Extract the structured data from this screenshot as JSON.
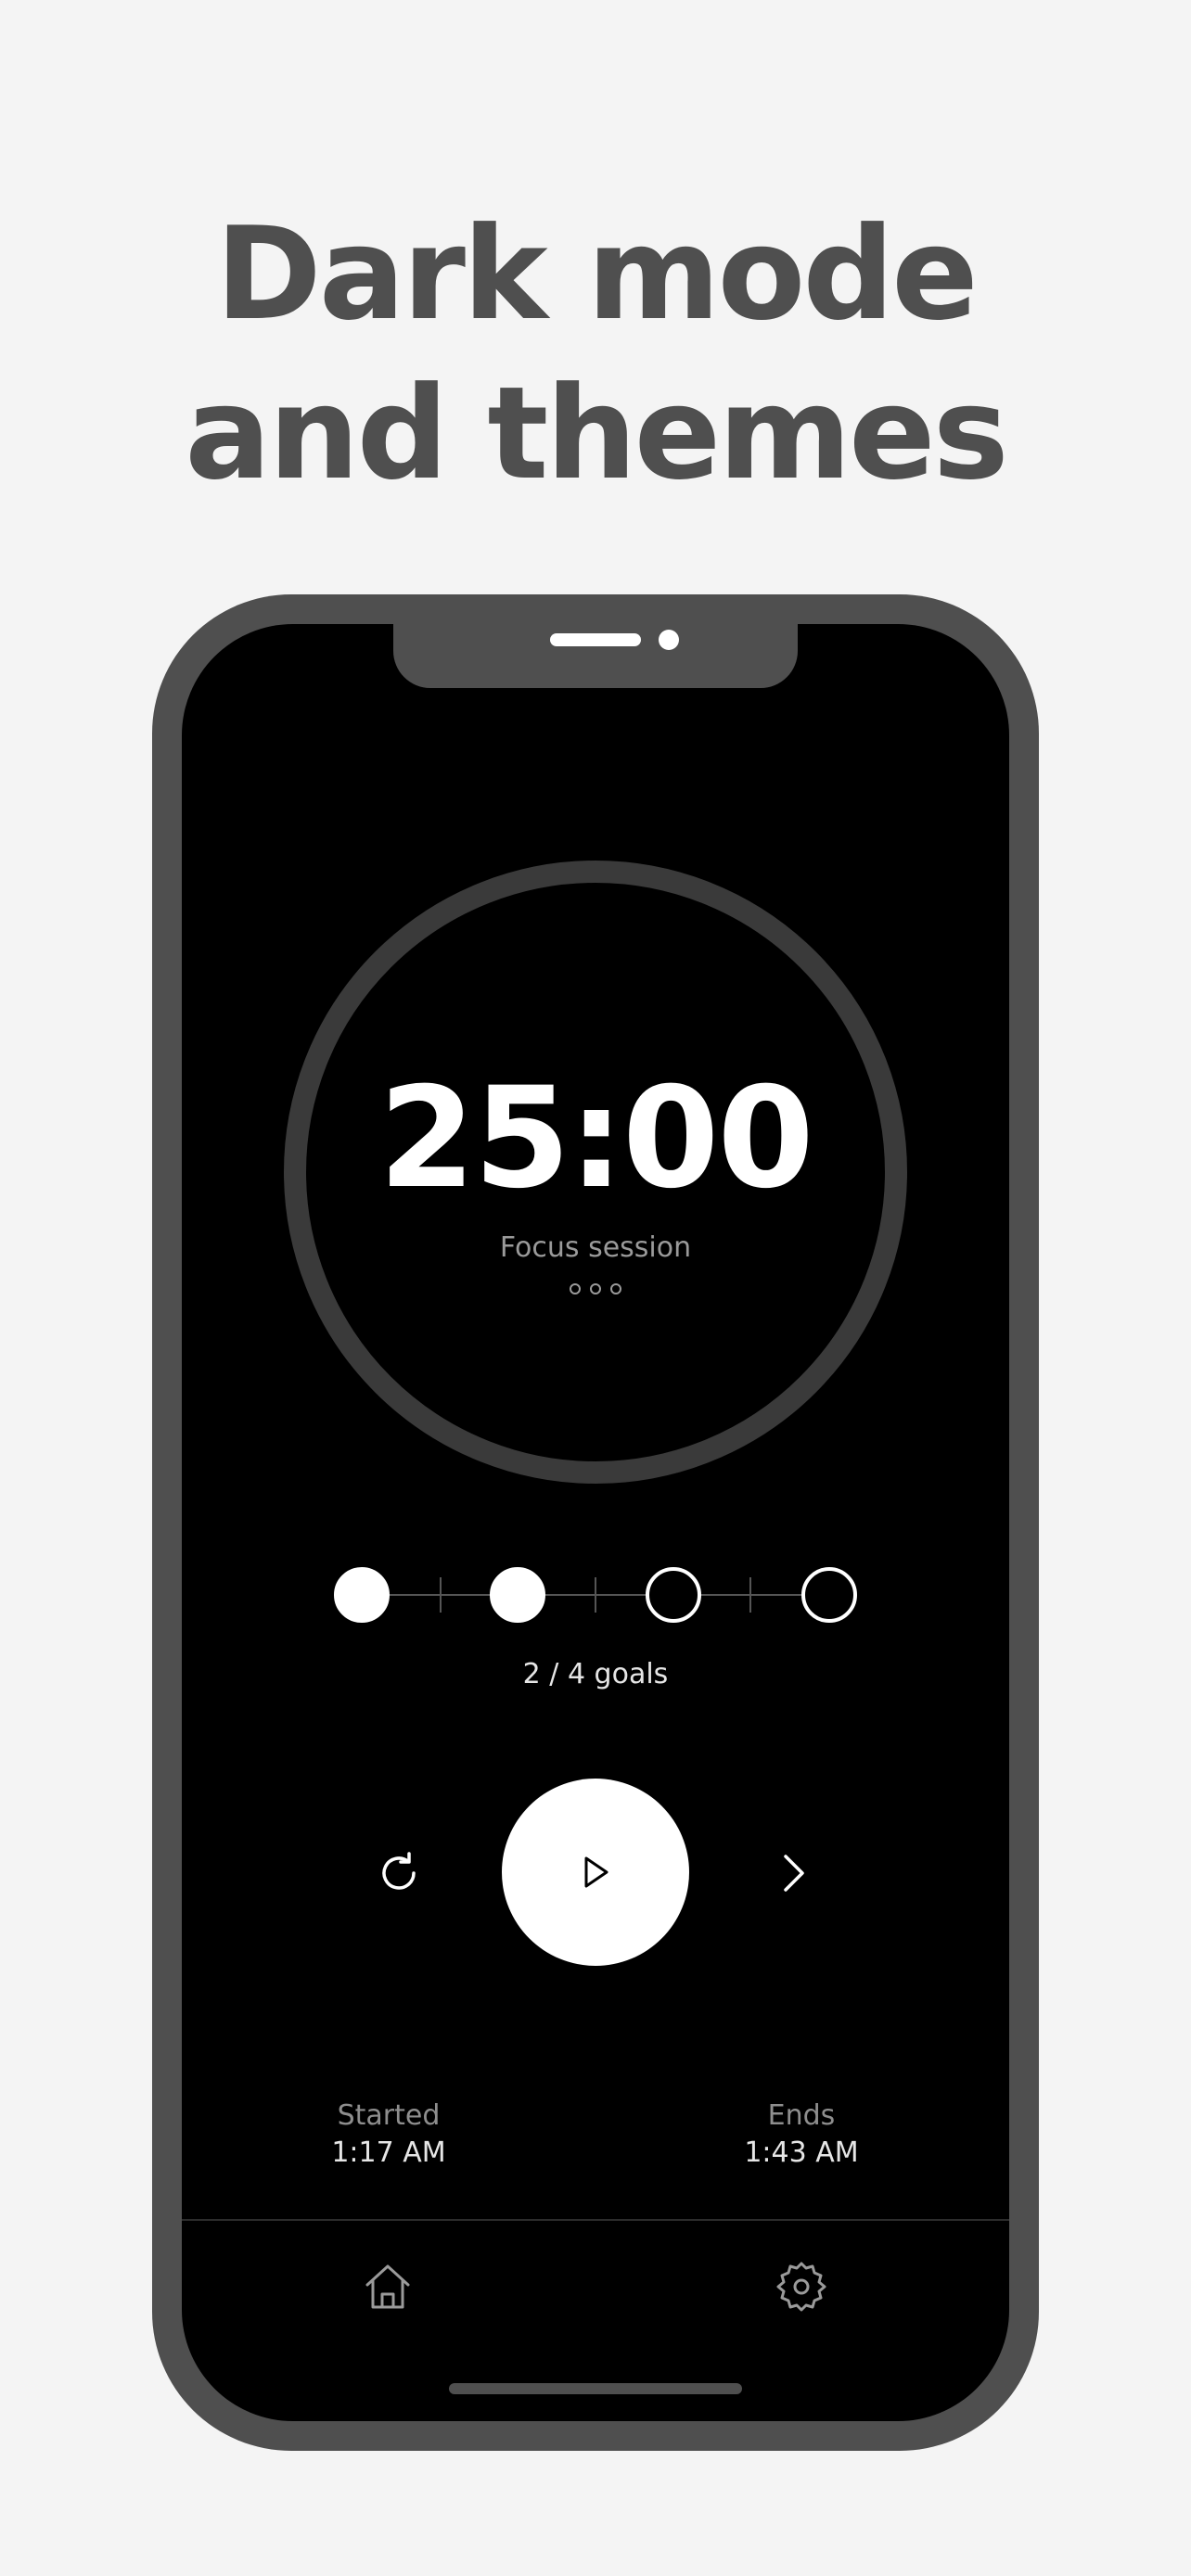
{
  "headline": {
    "line1": "Dark mode",
    "line2": "and themes"
  },
  "timer": {
    "time": "25:00",
    "label": "Focus session"
  },
  "goals": {
    "completed": 2,
    "total": 4,
    "text": "2 / 4 goals"
  },
  "controls": {
    "reset_icon": "refresh-icon",
    "play_icon": "play-icon",
    "next_icon": "chevron-right-icon"
  },
  "session": {
    "started_label": "Started",
    "started_time": "1:17 AM",
    "ends_label": "Ends",
    "ends_time": "1:43 AM"
  },
  "tabbar": {
    "home_icon": "home-icon",
    "settings_icon": "gear-icon"
  },
  "colors": {
    "background": "#f4f4f4",
    "frame": "#4f4f4f",
    "screen": "#000000",
    "accent": "#ffffff",
    "ring": "#3a3a3a"
  }
}
